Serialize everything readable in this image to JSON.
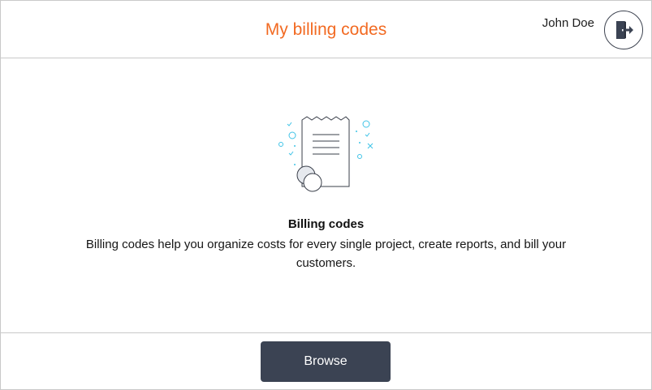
{
  "header": {
    "title": "My billing codes",
    "user_name": "John Doe",
    "logout_icon": "logout-door-icon"
  },
  "empty_state": {
    "illustration_icon": "receipt-coins-icon",
    "title": "Billing codes",
    "description": "Billing codes help you organize costs for every single project, create reports, and bill your customers."
  },
  "footer": {
    "browse_label": "Browse"
  },
  "colors": {
    "title": "#f26a22",
    "button_bg": "#3b4353",
    "accent": "#3fc3e7"
  }
}
